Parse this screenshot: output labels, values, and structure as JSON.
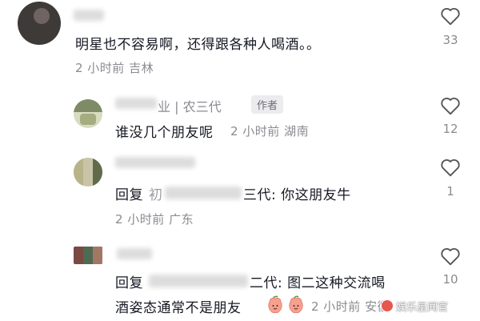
{
  "comments": [
    {
      "text": "明星也不容易啊，还得跟各种人喝酒。。",
      "meta": "2 小时前  吉林",
      "likes": "33"
    },
    {
      "name": "业 | 农三代",
      "author_badge": "作者",
      "text": "谁没几个朋友呢",
      "meta": "2 小时前  湖南",
      "likes": "12"
    },
    {
      "reply_prefix": "回复",
      "reply_name_visible": "初",
      "reply_suffix": "三代: 你这朋友牛",
      "meta": "2 小时前  广东",
      "likes": "1"
    },
    {
      "reply_prefix": "回复",
      "reply_suffix": "二代: 图二这种交流喝",
      "text_line2": "酒姿态通常不是朋友",
      "meta": "2 小时前  安徽",
      "likes": "10"
    }
  ],
  "watermark": "娱乐星闻官",
  "icons": {
    "like": "heart-outline-icon",
    "emoji": "peach-emoji-icon"
  }
}
